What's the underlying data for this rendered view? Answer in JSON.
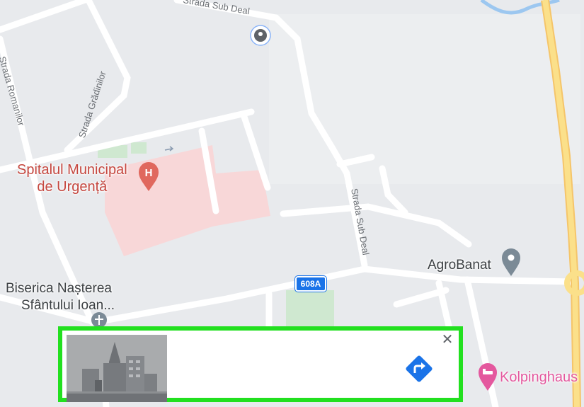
{
  "map": {
    "streets": {
      "sub_deal_top": "Strada Sub Deal",
      "romanilor": "Strada Romanilor",
      "gradinilor": "Strada Grădinilor",
      "sub_deal": "Strada Sub Deal"
    },
    "route_shield": "608A",
    "pois": {
      "hospital_line1": "Spitalul Municipal",
      "hospital_line2": "de Urgență",
      "church_line1": "Biserica Nașterea",
      "church_line2": "Sfântului Ioan...",
      "agrobanat": "AgroBanat",
      "kolpinghaus": "Kolpinghaus"
    }
  },
  "info_card": {
    "close_label": "✕"
  },
  "colors": {
    "map_background": "#e8eaed",
    "road": "#ffffff",
    "highway": "#fbe08a",
    "hospital_area": "#f8d7d8",
    "park": "#c8e6c9",
    "water": "#9cc7f0",
    "hospital_pin": "#e0685e",
    "poi_pin": "#7b8a96",
    "kolping_pin": "#e4589e",
    "card_border": "#22e01f",
    "directions": "#1a73e8"
  },
  "icons": [
    "location-marker-icon",
    "hospital-icon",
    "place-icon",
    "hotel-icon",
    "directions-icon",
    "close-icon"
  ]
}
